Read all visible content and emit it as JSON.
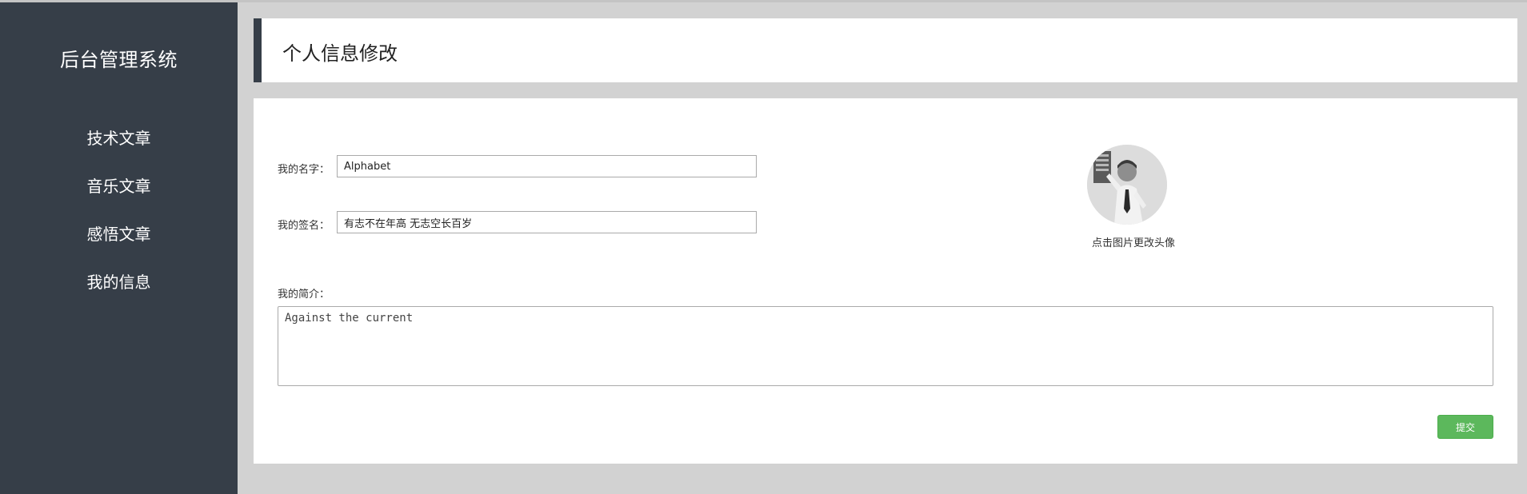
{
  "sidebar": {
    "brand": "后台管理系统",
    "items": [
      {
        "label": "技术文章"
      },
      {
        "label": "音乐文章"
      },
      {
        "label": "感悟文章"
      },
      {
        "label": "我的信息"
      }
    ],
    "bg_color": "#363e48"
  },
  "header": {
    "title": "个人信息修改"
  },
  "form": {
    "name_label": "我的名字：",
    "name_value": "Alphabet",
    "signature_label": "我的签名：",
    "signature_value": "有志不在年高 无志空长百岁",
    "bio_label": "我的简介：",
    "bio_value": "Against the current",
    "avatar_caption": "点击图片更改头像",
    "submit_label": "提交",
    "submit_color": "#5cb85c"
  }
}
